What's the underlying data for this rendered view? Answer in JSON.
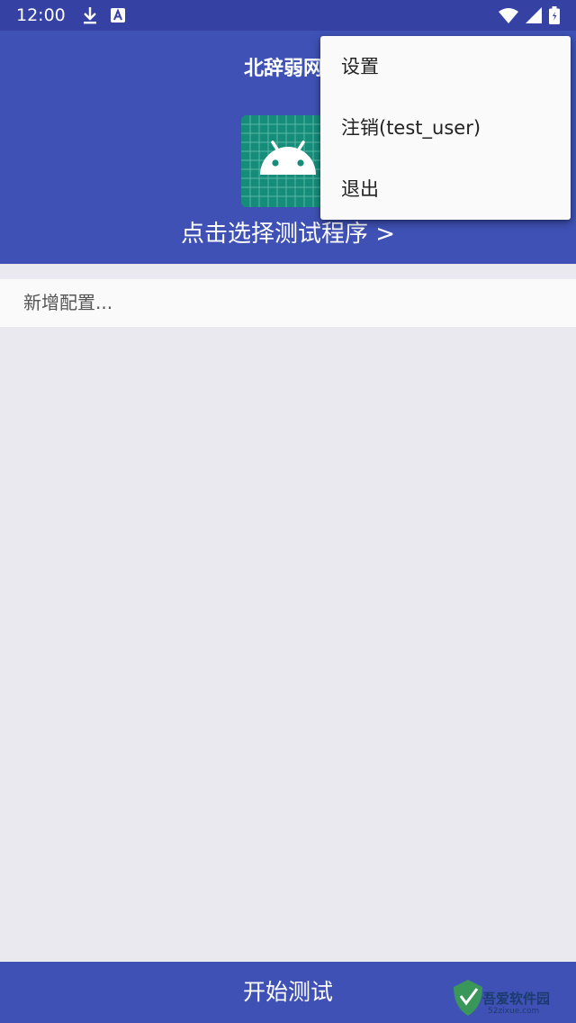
{
  "status_bar": {
    "time": "12:00",
    "left_icons": [
      "download-icon",
      "font-a-icon"
    ],
    "right_icons": [
      "wifi-icon",
      "signal-icon",
      "battery-icon"
    ],
    "background": "#3542a4"
  },
  "header": {
    "title": "北辞弱网(",
    "select_program": "点击选择测试程序 >",
    "background": "#3f51b5"
  },
  "config": {
    "add_label": "新增配置..."
  },
  "menu": {
    "items": [
      {
        "label": "设置"
      },
      {
        "label": "注销(test_user)"
      },
      {
        "label": "退出"
      }
    ]
  },
  "bottom": {
    "start_label": "开始测试"
  },
  "watermark": {
    "name": "吾爱软件园",
    "url": "52zixue.com"
  }
}
